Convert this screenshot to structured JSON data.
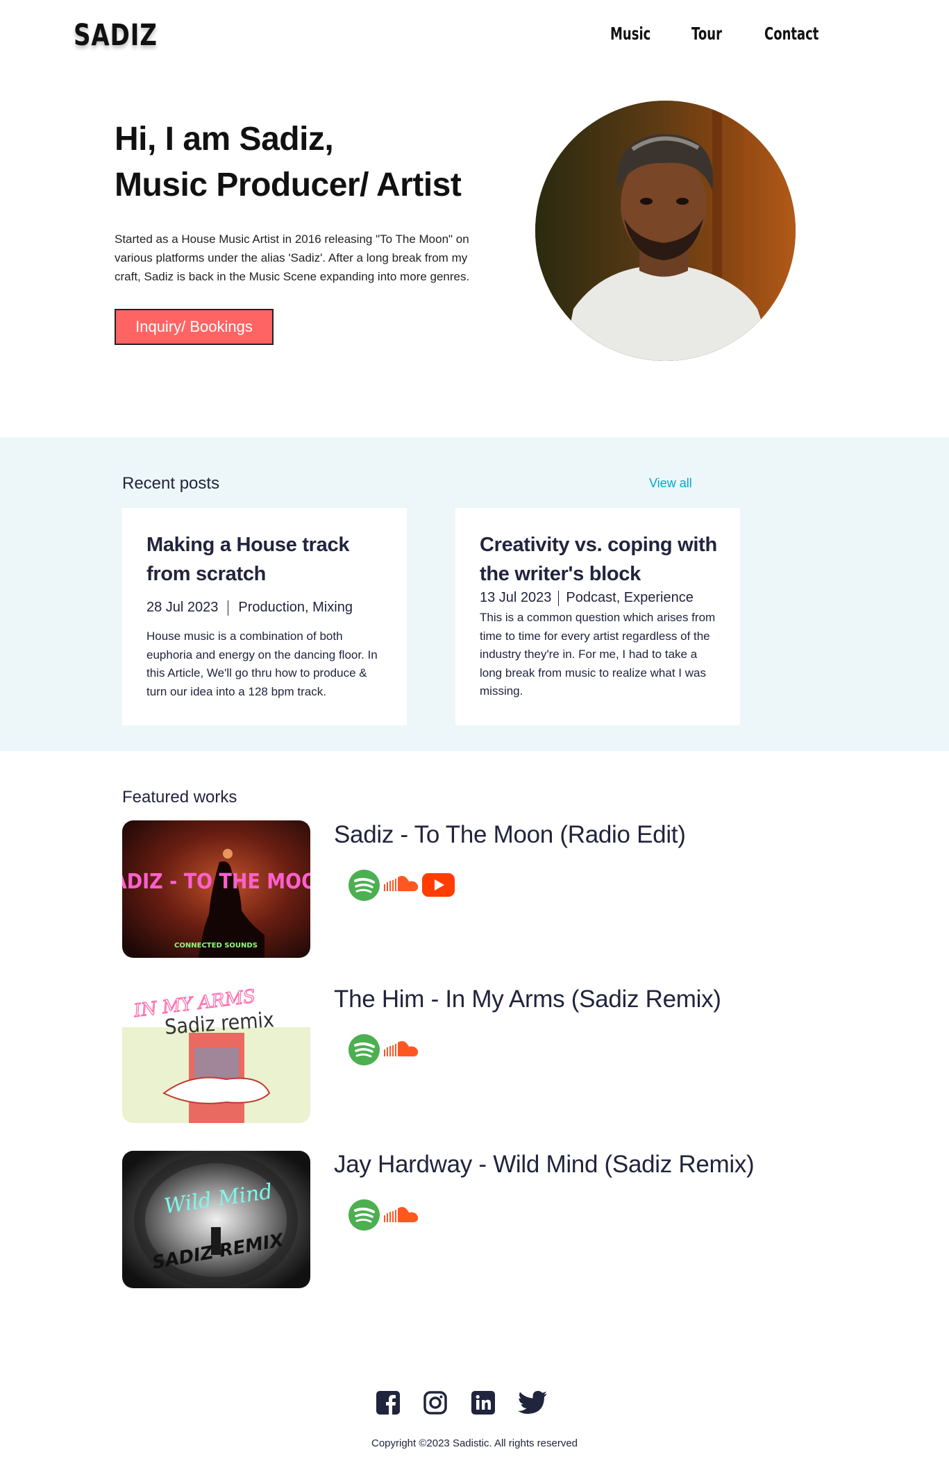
{
  "header": {
    "logo": "SADIZ",
    "nav": [
      "Music",
      "Tour",
      "Contact"
    ]
  },
  "hero": {
    "title_line1": "Hi, I am Sadiz,",
    "title_line2": "Music Producer/ Artist",
    "text": "Started as a House Music Artist in 2016 releasing \"To The Moon\" on various platforms under the alias 'Sadiz'. After a long break from my craft, Sadiz is back in the Music Scene expanding into more genres.",
    "button": "Inquiry/ Bookings"
  },
  "posts": {
    "heading": "Recent posts",
    "view_all": "View all",
    "items": [
      {
        "title": "Making a House track from scratch",
        "date": "28 Jul 2023",
        "tags": "Production, Mixing",
        "text": "House music is a combination of both euphoria and energy on the dancing floor. In this Article, We'll go thru how to produce & turn our idea into a 128 bpm track."
      },
      {
        "title": "Creativity vs. coping with the writer's block",
        "date": "13 Jul 2023",
        "tags": "Podcast, Experience",
        "text": "This is a common question which arises from time to time for every artist regardless of the industry they're in. For me, I had to take a long break from music to realize what I was missing."
      }
    ]
  },
  "works": {
    "heading": "Featured works",
    "items": [
      {
        "title": "Sadiz - To The Moon (Radio Edit)",
        "cover_text": "SADIZ - TO THE MOON",
        "cover_sub": "CONNECTED SOUNDS",
        "platforms": [
          "spotify-icon",
          "soundcloud-icon",
          "youtube-icon"
        ]
      },
      {
        "title": "The Him - In My Arms (Sadiz Remix)",
        "cover_text": "IN MY ARMS",
        "cover_sub": "Sadiz remix",
        "platforms": [
          "spotify-icon",
          "soundcloud-icon"
        ]
      },
      {
        "title": "Jay Hardway - Wild Mind (Sadiz Remix)",
        "cover_text": "Wild Mind",
        "cover_sub": "SADIZ REMIX",
        "platforms": [
          "spotify-icon",
          "soundcloud-icon"
        ]
      }
    ]
  },
  "footer": {
    "icons": [
      "facebook-icon",
      "instagram-icon",
      "linkedin-icon",
      "twitter-icon"
    ],
    "copyright": "Copyright ©2023 Sadistic. All rights reserved"
  },
  "colors": {
    "accent": "#FF6464",
    "section_bg": "#EDF7FA",
    "link": "#00A8CC",
    "text_dark": "#21243D",
    "spotify": "#4CAF50",
    "soundcloud": "#FF5722",
    "youtube": "#FF3D00"
  }
}
